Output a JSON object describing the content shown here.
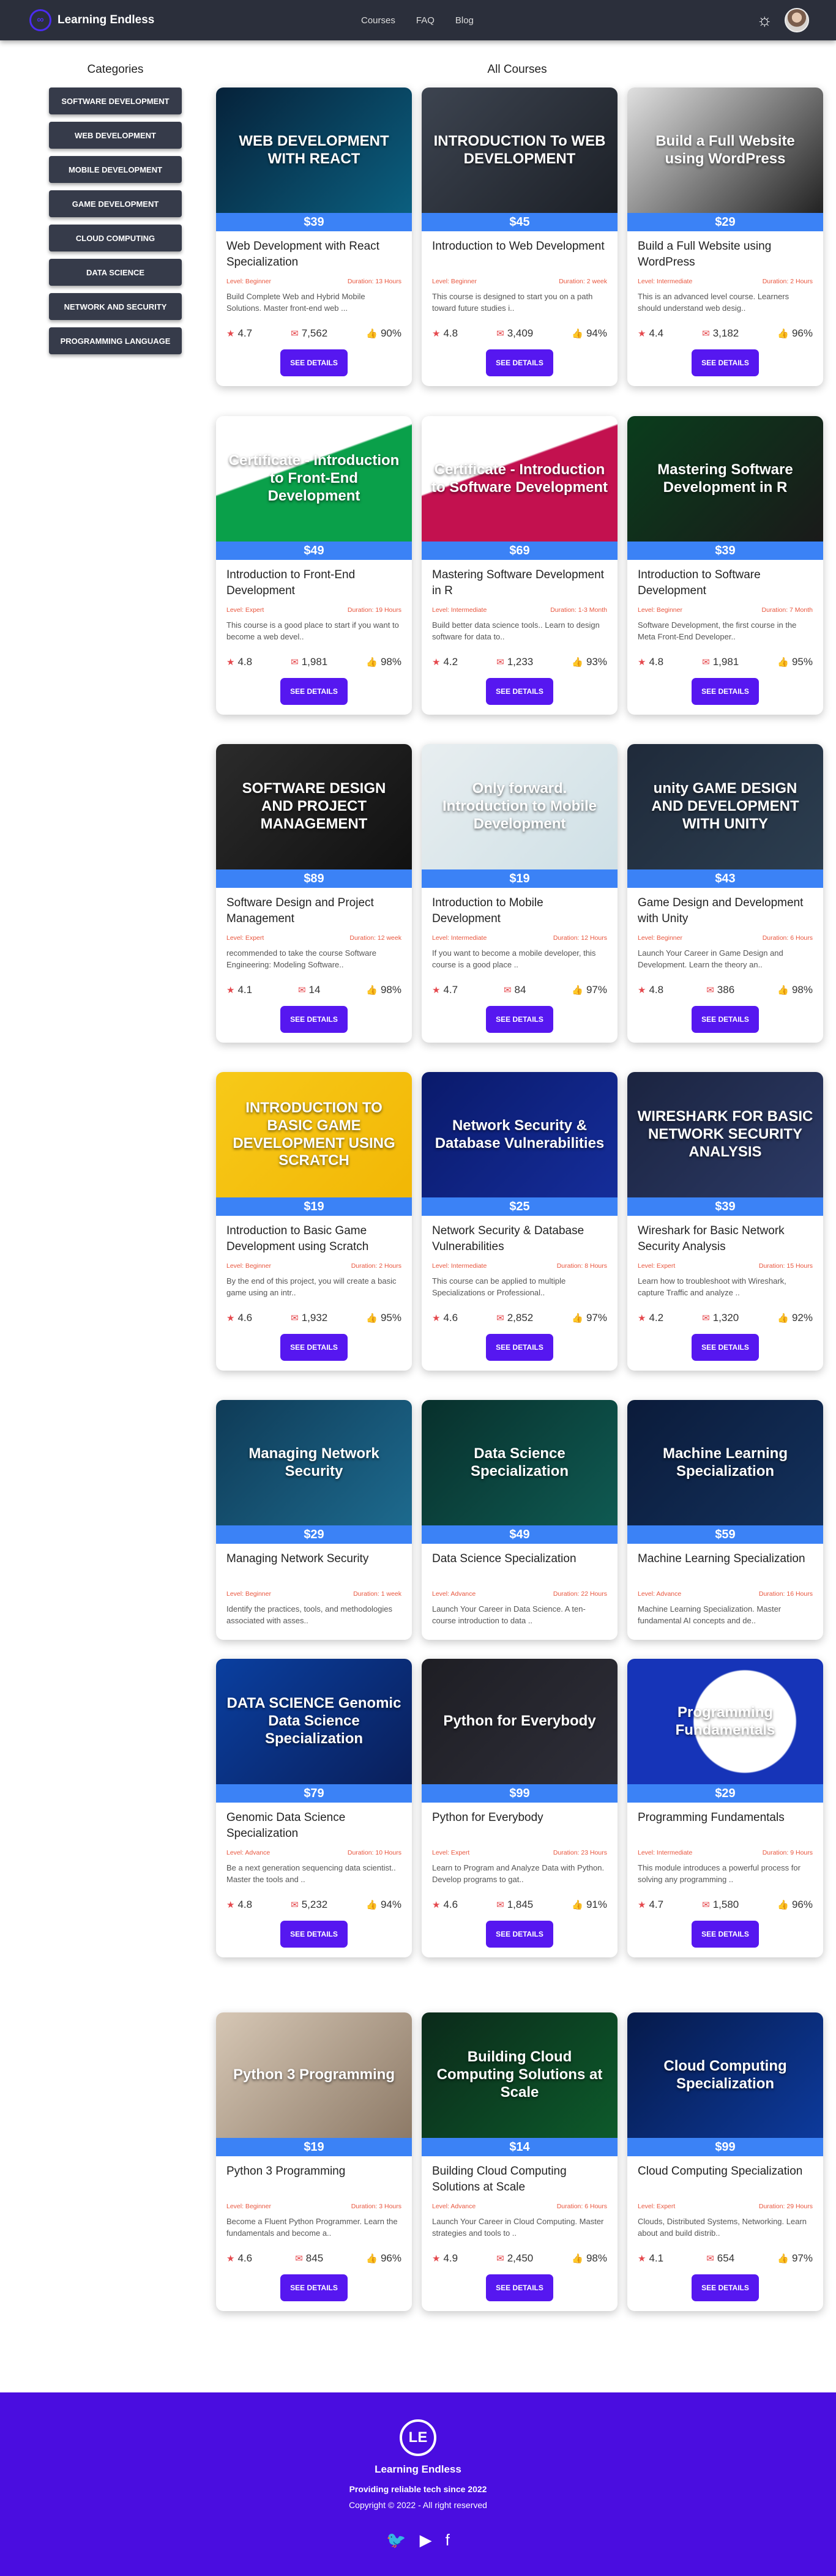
{
  "nav": {
    "brand": "Learning Endless",
    "logo_icon": "infinity-logo-icon",
    "links": [
      "Courses",
      "FAQ",
      "Blog"
    ]
  },
  "sidebar": {
    "title": "Categories",
    "items": [
      "SOFTWARE DEVELOPMENT",
      "WEB DEVELOPMENT",
      "MOBILE DEVELOPMENT",
      "GAME DEVELOPMENT",
      "CLOUD COMPUTING",
      "DATA SCIENCE",
      "NETWORK AND SECURITY",
      "PROGRAMMING LANGUAGE"
    ]
  },
  "main": {
    "title": "All Courses"
  },
  "button_label": "SEE DETAILS",
  "courses": [
    {
      "thumb": "WEB DEVELOPMENT WITH REACT",
      "bg": "linear-gradient(135deg,#06223a,#0b5f7f)",
      "price": "$39",
      "title": "Web Development with React Specialization",
      "level": "Level: Beginner",
      "duration": "Duration: 13 Hours",
      "desc": "Build Complete Web and Hybrid Mobile Solutions. Master front-end web ...",
      "rating": "4.7",
      "reviews": "7,562",
      "pct": "90%"
    },
    {
      "thumb": "INTRODUCTION To WEB DEVELOPMENT",
      "bg": "linear-gradient(135deg,#3d4450,#1c2027)",
      "price": "$45",
      "title": "Introduction to Web Development",
      "level": "Level: Beginner",
      "duration": "Duration: 2 week",
      "desc": "This course is designed to start you on a path toward future studies i..",
      "rating": "4.8",
      "reviews": "3,409",
      "pct": "94%"
    },
    {
      "thumb": "Build a Full Website using WordPress",
      "bg": "linear-gradient(135deg,#e0e0e0,#222)",
      "price": "$29",
      "title": "Build a Full Website using WordPress",
      "level": "Level: Intermediate",
      "duration": "Duration: 2 Hours",
      "desc": "This is an advanced level course. Learners should understand web desig..",
      "rating": "4.4",
      "reviews": "3,182",
      "pct": "96%"
    },
    {
      "thumb": "Certificate - Introduction to Front-End Development",
      "bg": "linear-gradient(160deg,#ffffff 40%,#0aa04a 41%)",
      "price": "$49",
      "title": "Introduction to Front-End Development",
      "level": "Level: Expert",
      "duration": "Duration: 19 Hours",
      "desc": "This course is a good place to start if you want to become a web devel..",
      "rating": "4.8",
      "reviews": "1,981",
      "pct": "98%"
    },
    {
      "thumb": "Certificate - Introduction to Software Development",
      "bg": "linear-gradient(160deg,#ffffff 40%,#c3114f 41%)",
      "price": "$69",
      "title": "Mastering Software Development in R",
      "level": "Level: Intermediate",
      "duration": "Duration: 1-3 Month",
      "desc": "Build better data science tools.. Learn to design software for data to..",
      "rating": "4.2",
      "reviews": "1,233",
      "pct": "93%"
    },
    {
      "thumb": "Mastering Software Development in R",
      "bg": "linear-gradient(135deg,#0a3d1c,#1a1a1a)",
      "price": "$39",
      "title": "Introduction to Software Development",
      "level": "Level: Beginner",
      "duration": "Duration: 7 Month",
      "desc": "Software Development, the first course in the Meta Front-End Developer..",
      "rating": "4.8",
      "reviews": "1,981",
      "pct": "95%"
    },
    {
      "thumb": "SOFTWARE DESIGN AND PROJECT MANAGEMENT",
      "bg": "linear-gradient(135deg,#2b2b2b,#111)",
      "price": "$89",
      "title": "Software Design and Project Management",
      "level": "Level: Expert",
      "duration": "Duration: 12 week",
      "desc": "recommended to take the course Software Engineering: Modeling Software..",
      "rating": "4.1",
      "reviews": "14",
      "pct": "98%"
    },
    {
      "thumb": "Only forward. Introduction to Mobile Development",
      "bg": "linear-gradient(135deg,#e8eef0,#cfe0e6)",
      "price": "$19",
      "title": "Introduction to Mobile Development",
      "level": "Level: Intermediate",
      "duration": "Duration: 12 Hours",
      "desc": "If you want to become a mobile developer, this course is a good place ..",
      "rating": "4.7",
      "reviews": "84",
      "pct": "97%"
    },
    {
      "thumb": "unity GAME DESIGN AND DEVELOPMENT WITH UNITY",
      "bg": "linear-gradient(135deg,#1f2a3a,#2c3e50)",
      "price": "$43",
      "title": "Game Design and Development with Unity",
      "level": "Level: Beginner",
      "duration": "Duration: 6 Hours",
      "desc": "Launch Your Career in Game Design and Development. Learn the theory an..",
      "rating": "4.8",
      "reviews": "386",
      "pct": "98%"
    },
    {
      "thumb": "INTRODUCTION TO BASIC GAME DEVELOPMENT USING SCRATCH",
      "bg": "linear-gradient(135deg,#f7c919,#f2b705)",
      "price": "$19",
      "title": "Introduction to Basic Game Development using Scratch",
      "level": "Level: Beginner",
      "duration": "Duration: 2 Hours",
      "desc": "By the end of this project, you will create a basic game using an intr..",
      "rating": "4.6",
      "reviews": "1,932",
      "pct": "95%"
    },
    {
      "thumb": "Network Security & Database Vulnerabilities",
      "bg": "linear-gradient(135deg,#0a1a6b,#152d9a)",
      "price": "$25",
      "title": "Network Security & Database Vulnerabilities",
      "level": "Level: Intermediate",
      "duration": "Duration: 8 Hours",
      "desc": "This course can be applied to multiple Specializations or Professional..",
      "rating": "4.6",
      "reviews": "2,852",
      "pct": "97%"
    },
    {
      "thumb": "WIRESHARK FOR BASIC NETWORK SECURITY ANALYSIS",
      "bg": "linear-gradient(135deg,#1b2440,#2c3a66)",
      "price": "$39",
      "title": "Wireshark for Basic Network Security Analysis",
      "level": "Level: Expert",
      "duration": "Duration: 15 Hours",
      "desc": "Learn how to troubleshoot with Wireshark, capture Traffic and analyze ..",
      "rating": "4.2",
      "reviews": "1,320",
      "pct": "92%"
    },
    {
      "thumb": "Managing Network Security",
      "bg": "linear-gradient(135deg,#0f3b57,#1d6a8e)",
      "price": "$29",
      "title": "Managing Network Security",
      "level": "Level: Beginner",
      "duration": "Duration: 1 week",
      "desc": "Identify the practices, tools, and methodologies associated with asses..",
      "rating": "",
      "reviews": "",
      "pct": ""
    },
    {
      "thumb": "Data Science Specialization",
      "bg": "linear-gradient(135deg,#08302c,#0f5a52)",
      "price": "$49",
      "title": "Data Science Specialization",
      "level": "Level: Advance",
      "duration": "Duration: 22 Hours",
      "desc": "Launch Your Career in Data Science. A ten-course introduction to data ..",
      "rating": "",
      "reviews": "",
      "pct": ""
    },
    {
      "thumb": "Machine Learning Specialization",
      "bg": "linear-gradient(135deg,#0b1b3a,#13315c)",
      "price": "$59",
      "title": "Machine Learning Specialization",
      "level": "Level: Advance",
      "duration": "Duration: 16 Hours",
      "desc": "Machine Learning Specialization. Master fundamental AI concepts and de..",
      "rating": "",
      "reviews": "",
      "pct": ""
    },
    {
      "thumb": "DATA SCIENCE Genomic Data Science Specialization",
      "bg": "linear-gradient(135deg,#0a3fa0,#0a1f5a)",
      "price": "$79",
      "title": "Genomic Data Science Specialization",
      "level": "Level: Advance",
      "duration": "Duration: 10 Hours",
      "desc": "Be a next generation sequencing data scientist.. Master the tools and ..",
      "rating": "4.8",
      "reviews": "5,232",
      "pct": "94%"
    },
    {
      "thumb": "Python for Everybody",
      "bg": "linear-gradient(135deg,#1e1e24,#2e2e38)",
      "price": "$99",
      "title": "Python for Everybody",
      "level": "Level: Expert",
      "duration": "Duration: 23 Hours",
      "desc": "Learn to Program and Analyze Data with Python. Develop programs to gat..",
      "rating": "4.6",
      "reviews": "1,845",
      "pct": "91%"
    },
    {
      "thumb": "Programming Fundamentals",
      "bg": "radial-gradient(circle at 60% 50%,#ffffff 0 38%,#1634b8 39%)",
      "price": "$29",
      "title": "Programming Fundamentals",
      "level": "Level: Intermediate",
      "duration": "Duration: 9 Hours",
      "desc": "This module introduces a powerful process for solving any programming ..",
      "rating": "4.7",
      "reviews": "1,580",
      "pct": "96%"
    },
    {
      "thumb": "Python 3 Programming",
      "bg": "linear-gradient(135deg,#d6c7b5,#8d7a67)",
      "price": "$19",
      "title": "Python 3 Programming",
      "level": "Level: Beginner",
      "duration": "Duration: 3 Hours",
      "desc": "Become a Fluent Python Programmer. Learn the fundamentals and become a..",
      "rating": "4.6",
      "reviews": "845",
      "pct": "96%"
    },
    {
      "thumb": "Building Cloud Computing Solutions at Scale",
      "bg": "linear-gradient(135deg,#0b2a1a,#0d5a2b)",
      "price": "$14",
      "title": "Building Cloud Computing Solutions at Scale",
      "level": "Level: Advance",
      "duration": "Duration: 6 Hours",
      "desc": "Launch Your Career in Cloud Computing. Master strategies and tools to ..",
      "rating": "4.9",
      "reviews": "2,450",
      "pct": "98%"
    },
    {
      "thumb": "Cloud Computing Specialization",
      "bg": "linear-gradient(135deg,#061a4a,#0d3a9c)",
      "price": "$99",
      "title": "Cloud Computing Specialization",
      "level": "Level: Expert",
      "duration": "Duration: 29 Hours",
      "desc": "Clouds, Distributed Systems, Networking. Learn about and build distrib..",
      "rating": "4.1",
      "reviews": "654",
      "pct": "97%"
    }
  ],
  "footer": {
    "logo_text": "LE",
    "name": "Learning Endless",
    "tagline": "Providing reliable tech since 2022",
    "copyright": "Copyright © 2022 - All right reserved",
    "social_icons": [
      "twitter-icon",
      "youtube-icon",
      "facebook-icon"
    ]
  }
}
